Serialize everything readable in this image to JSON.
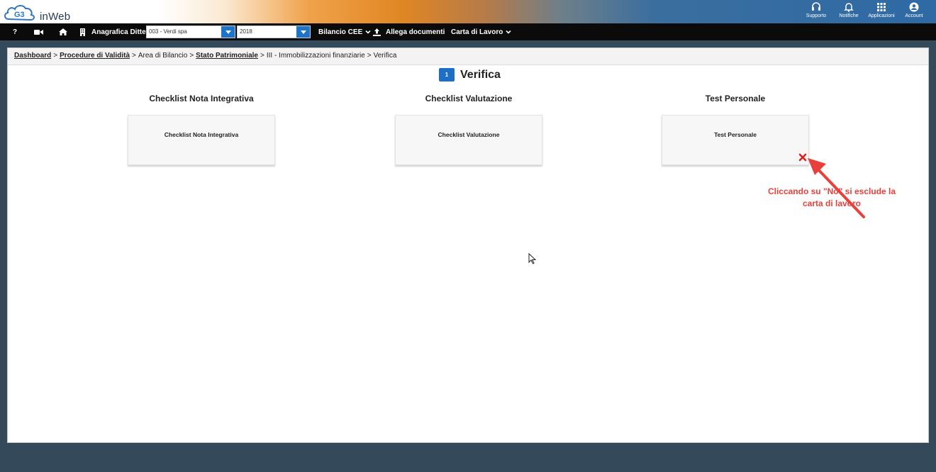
{
  "app": {
    "logo_text": "inWeb",
    "logo_mark": "G3"
  },
  "top_icons": [
    {
      "icon": "headset-icon",
      "label": "Supporto"
    },
    {
      "icon": "bell-icon",
      "label": "Notifiche"
    },
    {
      "icon": "grid-icon",
      "label": "Applicazioni"
    },
    {
      "icon": "account-icon",
      "label": "Account"
    }
  ],
  "menubar": {
    "help": "?",
    "anagrafica_label": "Anagrafica Ditte",
    "company_select": {
      "value": "003 - Verdi spa"
    },
    "year_select": {
      "value": "2018"
    },
    "bilancio_label": "Bilancio CEE",
    "allega_label": "Allega documenti",
    "carta_label": "Carta di Lavoro"
  },
  "breadcrumb": {
    "items": [
      {
        "text": "Dashboard",
        "link": true
      },
      {
        "text": "Procedure di Validità",
        "link": true
      },
      {
        "text": "Area di Bilancio",
        "link": false
      },
      {
        "text": "Stato Patrimoniale",
        "link": true
      },
      {
        "text": "III - Immobilizzazioni finanziarie",
        "link": false
      },
      {
        "text": "Verifica",
        "link": false
      }
    ],
    "separator": ">"
  },
  "page": {
    "step": "1",
    "title": "Verifica"
  },
  "columns": [
    {
      "title": "Checklist Nota Integrativa",
      "card_label": "Checklist Nota Integrativa",
      "excluded": false
    },
    {
      "title": "Checklist Valutazione",
      "card_label": "Checklist Valutazione",
      "excluded": false
    },
    {
      "title": "Test Personale",
      "card_label": "Test Personale",
      "excluded": true
    }
  ],
  "annotation": {
    "line1": "Cliccando su \"No\" si esclude la",
    "line2": "carta di lavoro"
  },
  "colors": {
    "accent_blue": "#1c6fc4",
    "annotation_red": "#e8413c",
    "menubar_bg": "#0b0b0b",
    "page_bg": "#34495a"
  }
}
